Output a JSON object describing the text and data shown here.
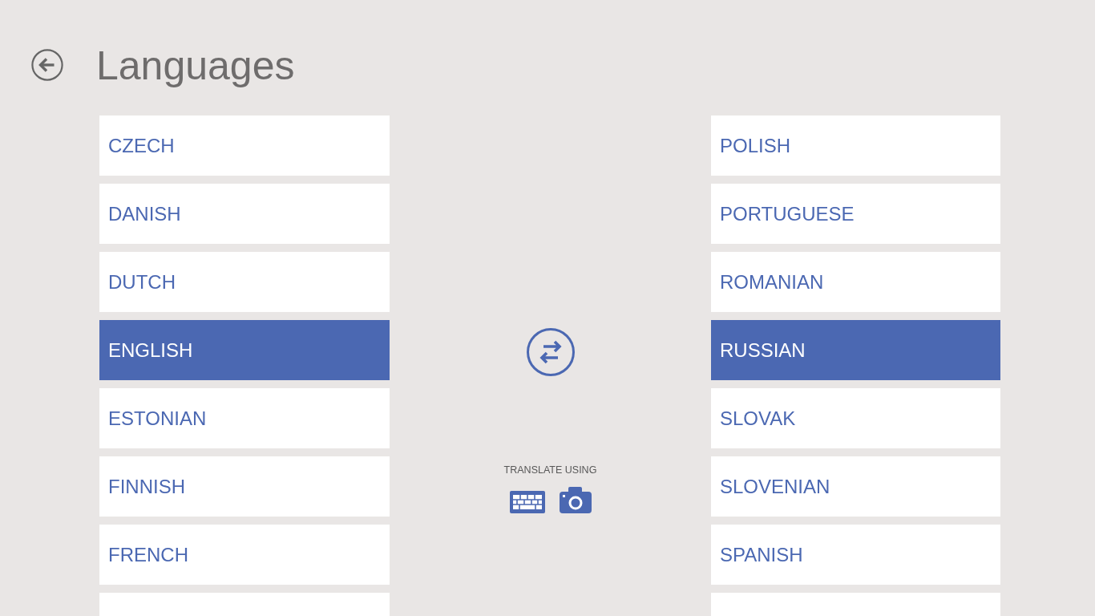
{
  "header": {
    "title": "Languages"
  },
  "source_languages": {
    "items": [
      {
        "label": "CZECH",
        "selected": false
      },
      {
        "label": "DANISH",
        "selected": false
      },
      {
        "label": "DUTCH",
        "selected": false
      },
      {
        "label": "ENGLISH",
        "selected": true
      },
      {
        "label": "ESTONIAN",
        "selected": false
      },
      {
        "label": "FINNISH",
        "selected": false
      },
      {
        "label": "FRENCH",
        "selected": false
      }
    ],
    "continues": true
  },
  "translate_using": {
    "label": "TRANSLATE USING",
    "methods": [
      {
        "kind": "keyboard"
      },
      {
        "kind": "camera"
      }
    ]
  },
  "target_languages": {
    "items": [
      {
        "label": "POLISH",
        "selected": false
      },
      {
        "label": "PORTUGUESE",
        "selected": false
      },
      {
        "label": "ROMANIAN",
        "selected": false
      },
      {
        "label": "RUSSIAN",
        "selected": true
      },
      {
        "label": "SLOVAK",
        "selected": false
      },
      {
        "label": "SLOVENIAN",
        "selected": false
      },
      {
        "label": "SPANISH",
        "selected": false
      }
    ],
    "continues": true
  }
}
